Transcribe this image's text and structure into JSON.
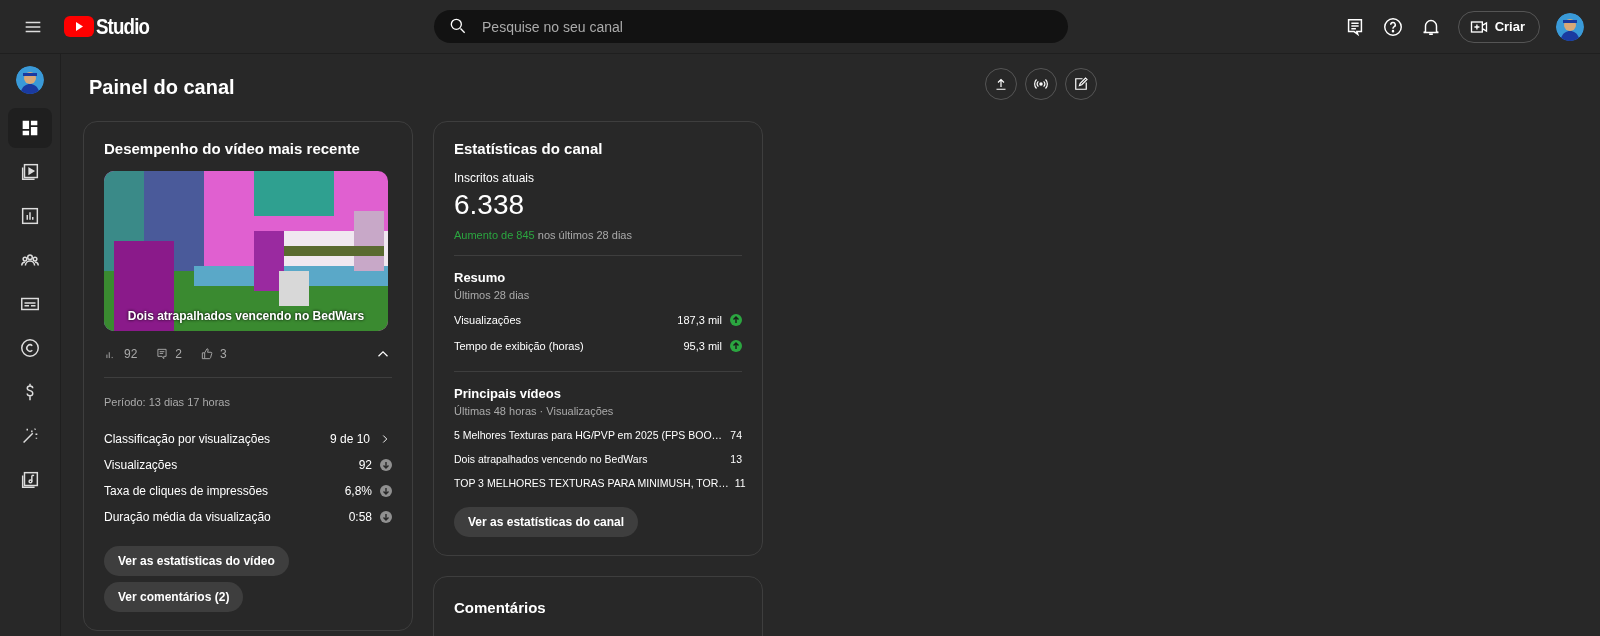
{
  "header": {
    "logo_text": "Studio",
    "search": {
      "placeholder": "Pesquise no seu canal"
    },
    "create_button": "Criar"
  },
  "sidebar": {
    "items": [
      {
        "selected": true
      },
      {
        "selected": false
      },
      {
        "selected": false
      },
      {
        "selected": false
      },
      {
        "selected": false
      },
      {
        "selected": false
      },
      {
        "selected": false
      },
      {
        "selected": false
      },
      {
        "selected": false
      }
    ]
  },
  "page_title": "Painel do canal",
  "latest_video": {
    "title": "Desempenho do vídeo mais recente",
    "thumbnail": {
      "kind": "picture",
      "caption": "Dois atrapalhados vencendo no BedWars"
    },
    "counts": [
      {
        "kind": "views",
        "value": "92"
      },
      {
        "kind": "comments",
        "value": "2"
      },
      {
        "kind": "likes",
        "value": "3"
      }
    ],
    "expanded": true,
    "period": "Período: 13 dias 17 horas",
    "metrics": [
      {
        "kind": "rank",
        "label": "Classificação por visualizações",
        "value": "9 de 10"
      },
      {
        "kind": "metric",
        "label": "Visualizações",
        "value": "92",
        "rising": false
      },
      {
        "kind": "metric",
        "label": "Taxa de cliques de impressões",
        "value": "6,8%",
        "rising": false
      },
      {
        "kind": "metric",
        "label": "Duração média da visualização",
        "value": "0:58",
        "rising": false
      }
    ],
    "buttons": [
      "Ver as estatísticas do vídeo",
      "Ver comentários (2)"
    ]
  },
  "channel_stats": {
    "title": "Estatísticas do canal",
    "subscribers_label": "Inscritos atuais",
    "subscribers": "6.338",
    "growth": {
      "highlight": "Aumento de 845",
      "rest": "nos últimos 28 dias"
    },
    "summary": {
      "title": "Resumo",
      "subtitle": "Últimos 28 dias",
      "rows": [
        {
          "label": "Visualizações",
          "value": "187,3 mil",
          "rising": true
        },
        {
          "label": "Tempo de exibição (horas)",
          "value": "95,3 mil",
          "rising": true
        }
      ]
    },
    "top_videos": {
      "title": "Principais vídeos",
      "subtitle": "Últimas 48 horas · Visualizações",
      "rows": [
        {
          "title": "5 Melhores Texturas para HG/PVP em 2025 (FPS BOO…",
          "views": "74"
        },
        {
          "title": "Dois atrapalhados vencendo no BedWars",
          "views": "13"
        },
        {
          "title": "TOP 3 MELHORES TEXTURAS PARA MINIMUSH, TOR…",
          "views": "11"
        }
      ]
    },
    "button": "Ver as estatísticas do canal"
  },
  "comments": {
    "title": "Comentários"
  }
}
